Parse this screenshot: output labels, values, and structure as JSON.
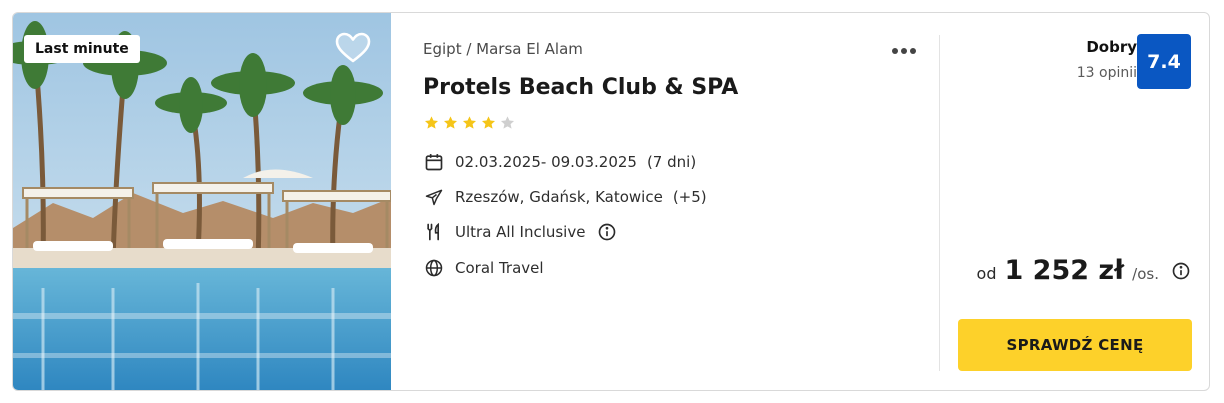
{
  "photo": {
    "badge": "Last minute",
    "alt": "pool with palm trees and cabanas"
  },
  "hotel": {
    "location": "Egipt / Marsa El Alam",
    "name": "Protels Beach Club & SPA",
    "stars": 4,
    "max_stars": 5,
    "dates": "02.03.2025- 09.03.2025",
    "duration": "(7 dni)",
    "departures": "Rzeszów, Gdańsk, Katowice",
    "departures_more": "(+5)",
    "board": "Ultra All Inclusive",
    "operator": "Coral Travel"
  },
  "rating": {
    "label": "Dobry",
    "count": "13 opinii",
    "score": "7.4"
  },
  "price": {
    "from": "od",
    "value": "1 252 zł",
    "unit": "/os."
  },
  "cta": {
    "label": "SPRAWDŹ CENĘ"
  },
  "colors": {
    "score_bg": "#0a57c2",
    "cta_bg": "#fdd12a",
    "star_filled": "#f5c518",
    "star_empty": "#cfcfcf"
  },
  "icons": {
    "favorite": "heart-outline-icon",
    "more": "more-horizontal-icon",
    "dates": "calendar-icon",
    "departures": "plane-icon",
    "board": "cutlery-icon",
    "operator": "globe-icon",
    "info": "info-circle-icon"
  }
}
